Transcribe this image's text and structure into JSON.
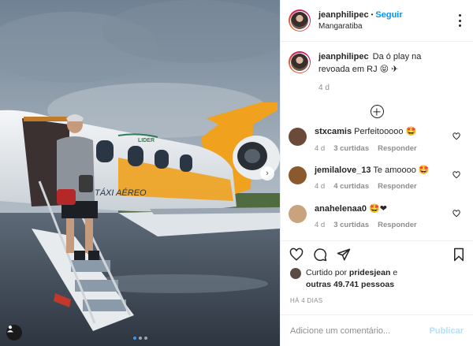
{
  "photo": {
    "plane_livery_text": "TÁXI AÉREO",
    "plane_logo_text": "LIDER",
    "carousel_dots": 3,
    "carousel_active": 1
  },
  "header": {
    "username": "jeanphilipec",
    "separator": "•",
    "follow_label": "Seguir",
    "location": "Mangaratiba"
  },
  "caption": {
    "username": "jeanphilipec",
    "text": "Da ó play na revoada em RJ",
    "emoji": "😝 ✈",
    "time": "4 d"
  },
  "comments": [
    {
      "username": "stxcamis",
      "text": "Perfeitooooo",
      "emoji": "🤩",
      "time": "4 d",
      "likes": "3 curtidas",
      "reply": "Responder",
      "avatar_color": "#6b4a3a"
    },
    {
      "username": "jemilalove_13",
      "text": "Te amoooo",
      "emoji": "🤩",
      "time": "4 d",
      "likes": "4 curtidas",
      "reply": "Responder",
      "avatar_color": "#8a5a2e"
    },
    {
      "username": "anahelenaa0",
      "text": "",
      "emoji": "🤩❤",
      "time": "4 d",
      "likes": "3 curtidas",
      "reply": "Responder",
      "avatar_color": "#c9a27e"
    }
  ],
  "likes": {
    "prefix": "Curtido por",
    "liker": "pridesjean",
    "conj": "e",
    "others": "outras 49.741 pessoas"
  },
  "time_ago": "HÁ 4 DIAS",
  "add_comment": {
    "placeholder": "Adicione um comentário...",
    "publish_label": "Publicar"
  },
  "colors": {
    "follow": "#0095f6",
    "publish_disabled": "#b2dffc",
    "secondary_text": "#8e8e8e",
    "border": "#efefef"
  }
}
